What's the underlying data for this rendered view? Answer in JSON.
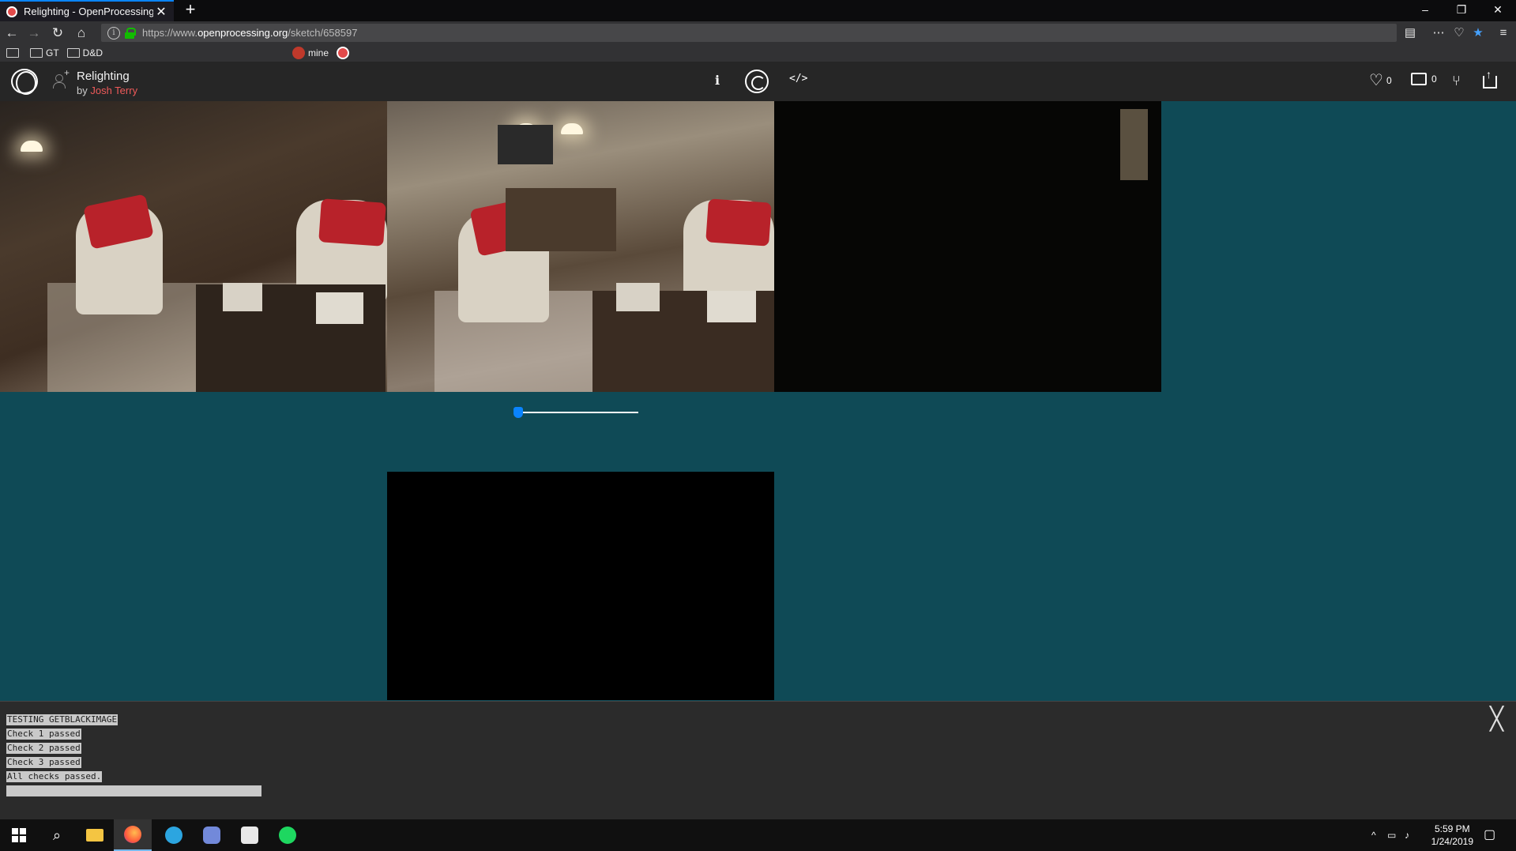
{
  "browser": {
    "tab_title": "Relighting - OpenProcessing",
    "new_tab_label": "+",
    "url_prefix": "https://www.",
    "url_domain": "openprocessing.org",
    "url_path": "/sketch/658597",
    "window_controls": [
      "–",
      "❐",
      "✕"
    ]
  },
  "bookmarks": {
    "folders": [
      "GT",
      "D&D"
    ],
    "named": [
      "mine"
    ],
    "icon_colors": [
      "#d44638",
      "#ff0000",
      "#e50914",
      "#ff6314",
      "#f0b400",
      "#ffb900",
      "#f5f5f5",
      "#3ddc84",
      "#1da1f2",
      "#12bc00",
      "#0088cc",
      "#1da1f2",
      "#00a4ef",
      "#4285f4",
      "#333333",
      "#0a66c2",
      "#1a73e8",
      "#1877f2",
      "#4a154b",
      "#ff0084",
      "#4285f4",
      "#dddddd",
      "#c0392b"
    ]
  },
  "sketch": {
    "title": "Relighting",
    "by_prefix": "by ",
    "author": "Josh Terry",
    "info_label": "i",
    "code_label": "</>",
    "likes": "0",
    "comments": "0"
  },
  "canvas": {
    "background": "#0f4a56",
    "slider_value": 0
  },
  "console": {
    "lines": [
      "TESTING GETBLACKIMAGE",
      "Check 1 passed",
      "Check 2 passed",
      "Check 3 passed",
      "All checks passed."
    ],
    "close_label": "╳"
  },
  "taskbar": {
    "time": "5:59 PM",
    "date": "1/24/2019",
    "apps": [
      "start",
      "search",
      "file-explorer",
      "firefox",
      "telegram",
      "discord",
      "slack",
      "spotify"
    ]
  }
}
